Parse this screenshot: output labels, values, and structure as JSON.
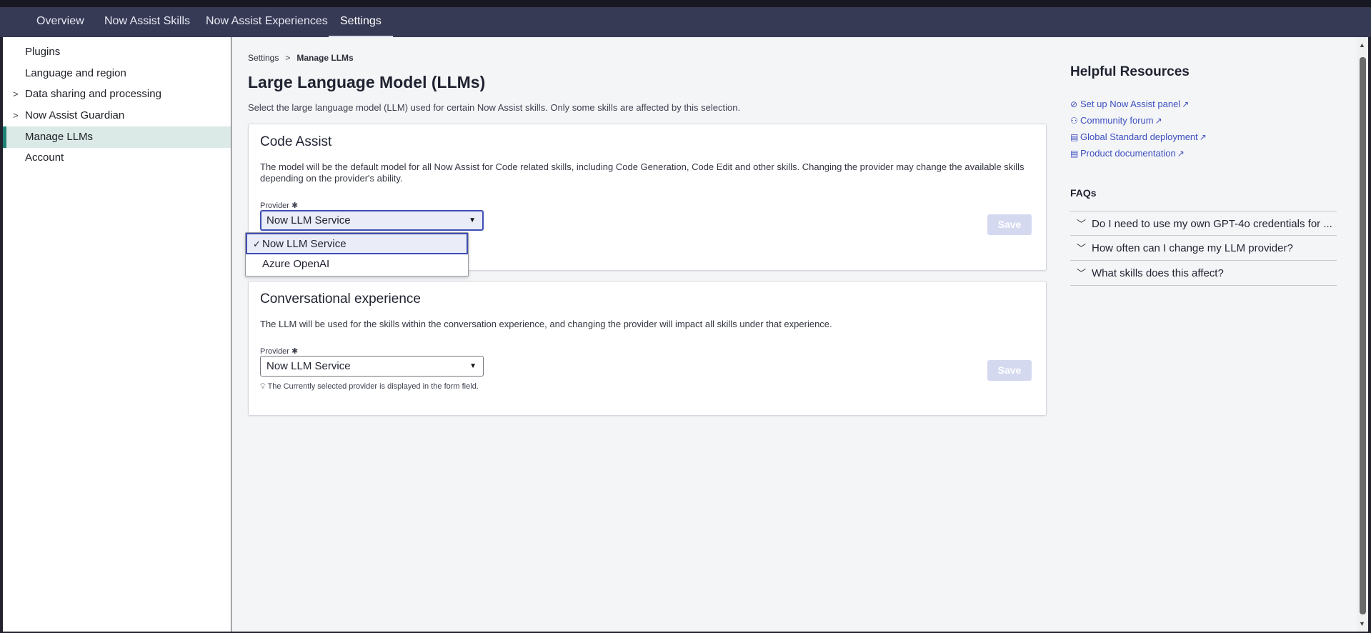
{
  "nav": {
    "tabs": [
      {
        "label": "Overview"
      },
      {
        "label": "Now Assist Skills"
      },
      {
        "label": "Now Assist Experiences"
      },
      {
        "label": "Settings"
      }
    ],
    "active_tab": "Settings"
  },
  "sidebar": {
    "items": [
      {
        "label": "Plugins",
        "expandable": false
      },
      {
        "label": "Language and region",
        "expandable": false
      },
      {
        "label": "Data sharing and processing",
        "expandable": true
      },
      {
        "label": "Now Assist Guardian",
        "expandable": true
      },
      {
        "label": "Manage LLMs",
        "expandable": false,
        "active": true
      },
      {
        "label": "Account",
        "expandable": false
      }
    ]
  },
  "breadcrumb": {
    "parent": "Settings",
    "separator": ">",
    "current": "Manage LLMs"
  },
  "page": {
    "title": "Large Language Model (LLMs)",
    "description": "Select the large language model (LLM) used for certain Now Assist skills. Only some skills are affected by this selection."
  },
  "code_assist": {
    "title": "Code Assist",
    "description": "The model will be the default model for all Now Assist for Code related skills, including Code Generation, Code Edit and other skills. Changing the provider may change the available skills depending on the provider's ability.",
    "provider_label": "Provider",
    "required_mark": "✱",
    "selected": "Now LLM Service",
    "options": [
      "Now LLM Service",
      "Azure OpenAI"
    ],
    "save_label": "Save",
    "dropdown_open": true
  },
  "conversational": {
    "title": "Conversational experience",
    "description": "The LLM will be used for the skills within the conversation experience, and changing the provider will impact all skills under that experience.",
    "provider_label": "Provider",
    "required_mark": "✱",
    "selected": "Now LLM Service",
    "hint": "The Currently selected provider is displayed in the form field.",
    "save_label": "Save"
  },
  "resources": {
    "title": "Helpful Resources",
    "links": [
      {
        "label": "Set up Now Assist panel",
        "icon": "compass-icon"
      },
      {
        "label": "Community forum",
        "icon": "people-icon"
      },
      {
        "label": "Global Standard deployment",
        "icon": "document-icon"
      },
      {
        "label": "Product documentation",
        "icon": "document-icon"
      }
    ]
  },
  "faqs": {
    "title": "FAQs",
    "items": [
      {
        "question": "Do I need to use my own GPT-4o credentials for ..."
      },
      {
        "question": "How often can I change my LLM provider?"
      },
      {
        "question": "What skills does this affect?"
      }
    ]
  },
  "colors": {
    "nav_bg": "#373a55",
    "accent": "#3d50c0",
    "active_sidebar": "#dbeae7",
    "active_marker": "#1f8476",
    "save_disabled": "#d5d9f0"
  }
}
